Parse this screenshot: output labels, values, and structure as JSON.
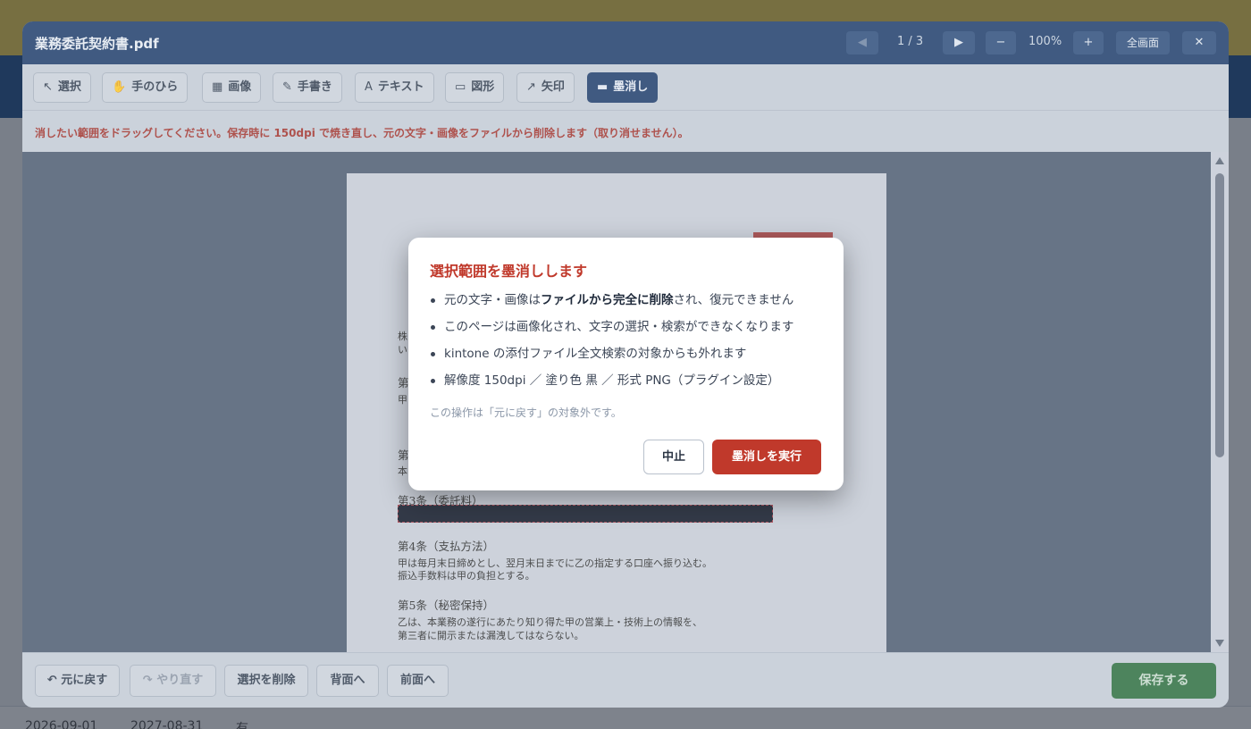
{
  "background": {
    "row_values": [
      "2026-09-01",
      "2027-08-31",
      "有"
    ]
  },
  "viewer": {
    "title": "業務委託契約書.pdf",
    "page_indicator": "1 / 3",
    "zoom": "100%",
    "prev_label": "◀",
    "next_label": "▶",
    "zoom_out_label": "−",
    "zoom_in_label": "+",
    "fullscreen_label": "全画面",
    "close_label": "✕"
  },
  "toolbar": {
    "tools": [
      {
        "icon": "↖",
        "label": "選択"
      },
      {
        "icon": "✋",
        "label": "手のひら"
      },
      {
        "icon": "▦",
        "label": "画像"
      },
      {
        "icon": "✎",
        "label": "手書き"
      },
      {
        "icon": "A",
        "label": "テキスト"
      },
      {
        "icon": "▭",
        "label": "図形"
      },
      {
        "icon": "↗",
        "label": "矢印"
      },
      {
        "icon": "▬",
        "label": "墨消し"
      }
    ],
    "active_tool": "墨消し"
  },
  "notice": "消したい範囲をドラッグしてください。保存時に 150dpi で焼き直し、元の文字・画像をファイルから削除します（取り消せません）。",
  "document": {
    "partial_lines": [
      "株",
      "い",
      "第",
      "甲",
      "第",
      "本"
    ],
    "art3_heading": "第3条（委託料）",
    "art4_heading": "第4条（支払方法）",
    "art4_line1": "甲は毎月末日締めとし、翌月末日までに乙の指定する口座へ振り込む。",
    "art4_line2": "振込手数料は甲の負担とする。",
    "art5_heading": "第5条（秘密保持）",
    "art5_line1": "乙は、本業務の遂行にあたり知り得た甲の営業上・技術上の情報を、",
    "art5_line2": "第三者に開示または漏洩してはならない。"
  },
  "footer": {
    "undo_label": "元に戻す",
    "redo_label": "やり直す",
    "delete_label": "選択を削除",
    "to_back_label": "背面へ",
    "to_front_label": "前面へ",
    "save_label": "保存する"
  },
  "dialog": {
    "title": "選択範囲を墨消しします",
    "item1_pre": "元の文字・画像は",
    "item1_bold": "ファイルから完全に削除",
    "item1_post": "され、復元できません",
    "item2": "このページは画像化され、文字の選択・検索ができなくなります",
    "item3": "kintone の添付ファイル全文検索の対象からも外れます",
    "item4": "解像度 150dpi ／ 塗り色 黒 ／ 形式 PNG（プラグイン設定）",
    "note": "この操作は「元に戻す」の対象外です。",
    "cancel_label": "中止",
    "confirm_label": "墨消しを実行"
  },
  "colors": {
    "header_bg": "#1d3b69",
    "danger": "#c0392b",
    "save_green": "#2c6e3e"
  }
}
